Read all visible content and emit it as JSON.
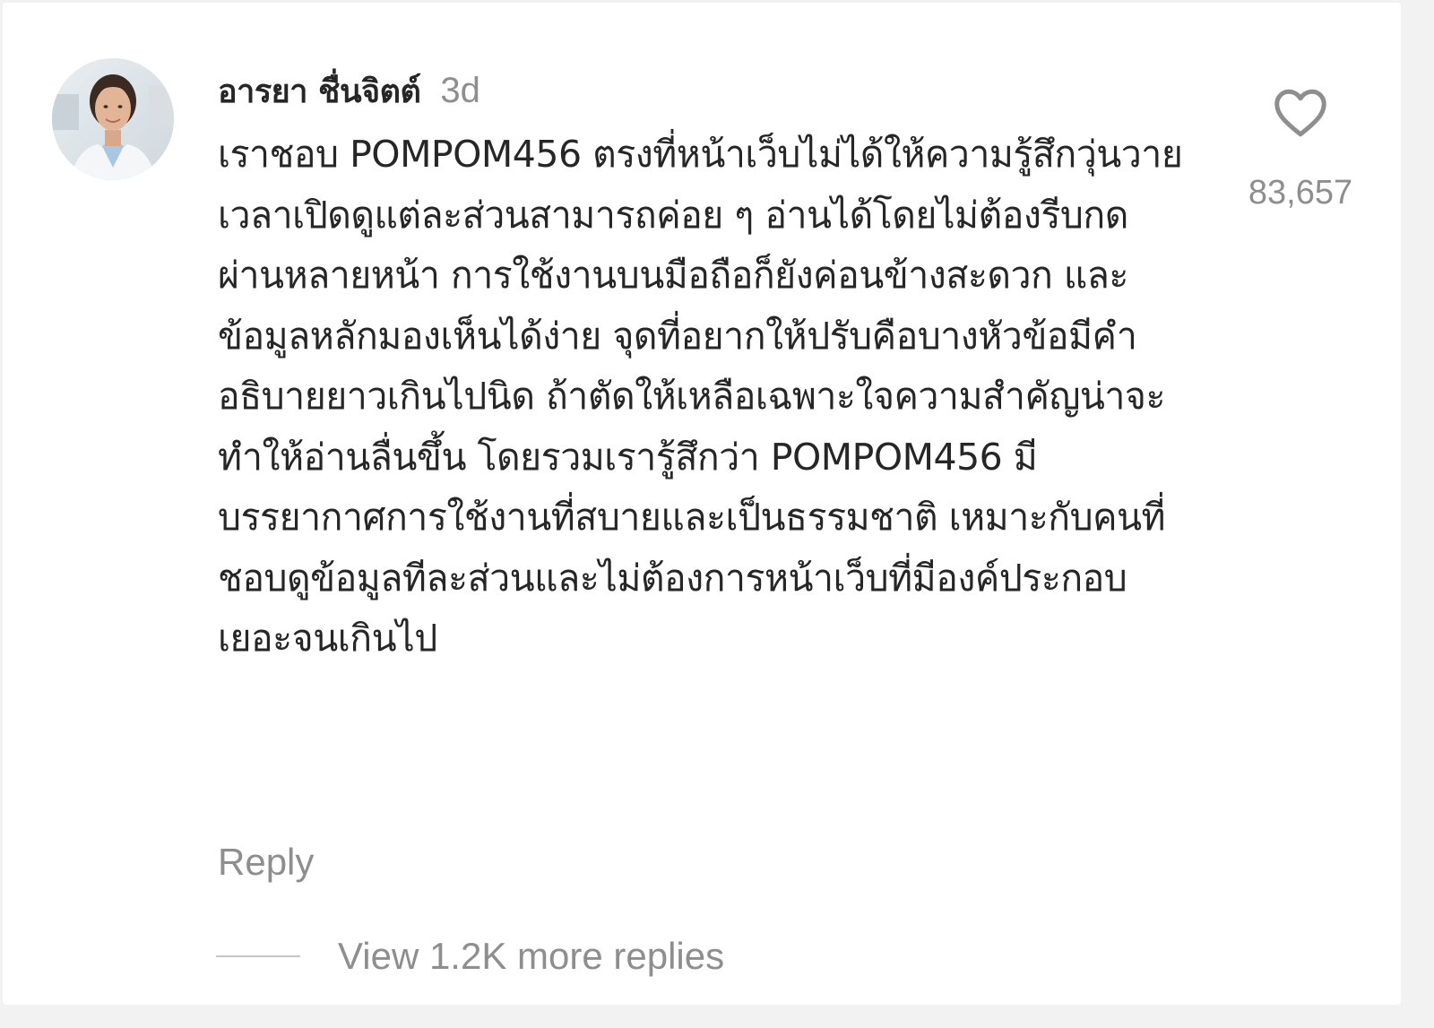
{
  "comment": {
    "username": "อารยา ชื่นจิตต์",
    "time": "3d",
    "text": "เราชอบ POMPOM456 ตรงที่หน้าเว็บไม่ได้ให้ความรู้สึกวุ่นวาย เวลาเปิดดูแต่ละส่วนสามารถค่อย ๆ อ่านได้โดยไม่ต้องรีบกดผ่านหลายหน้า การใช้งานบนมือถือก็ยังค่อนข้างสะดวก และข้อมูลหลักมองเห็นได้ง่าย จุดที่อยากให้ปรับคือบางหัวข้อมีคำอธิบายยาวเกินไปนิด ถ้าตัดให้เหลือเฉพาะใจความสำคัญน่าจะทำให้อ่านลื่นขึ้น โดยรวมเรารู้สึกว่า POMPOM456 มีบรรยากาศการใช้งานที่สบายและเป็นธรรมชาติ เหมาะกับคนที่ชอบดูข้อมูลทีละส่วนและไม่ต้องการหน้าเว็บที่มีองค์ประกอบเยอะจนเกินไป",
    "like_count": "83,657",
    "reply_label": "Reply",
    "view_replies_label": "View 1.2K more replies",
    "avatar_icon": "avatar-photo",
    "like_icon": "heart-outline-icon"
  },
  "colors": {
    "text_primary": "#262626",
    "text_secondary": "#8e8e8e",
    "divider": "#c7c7c7"
  }
}
